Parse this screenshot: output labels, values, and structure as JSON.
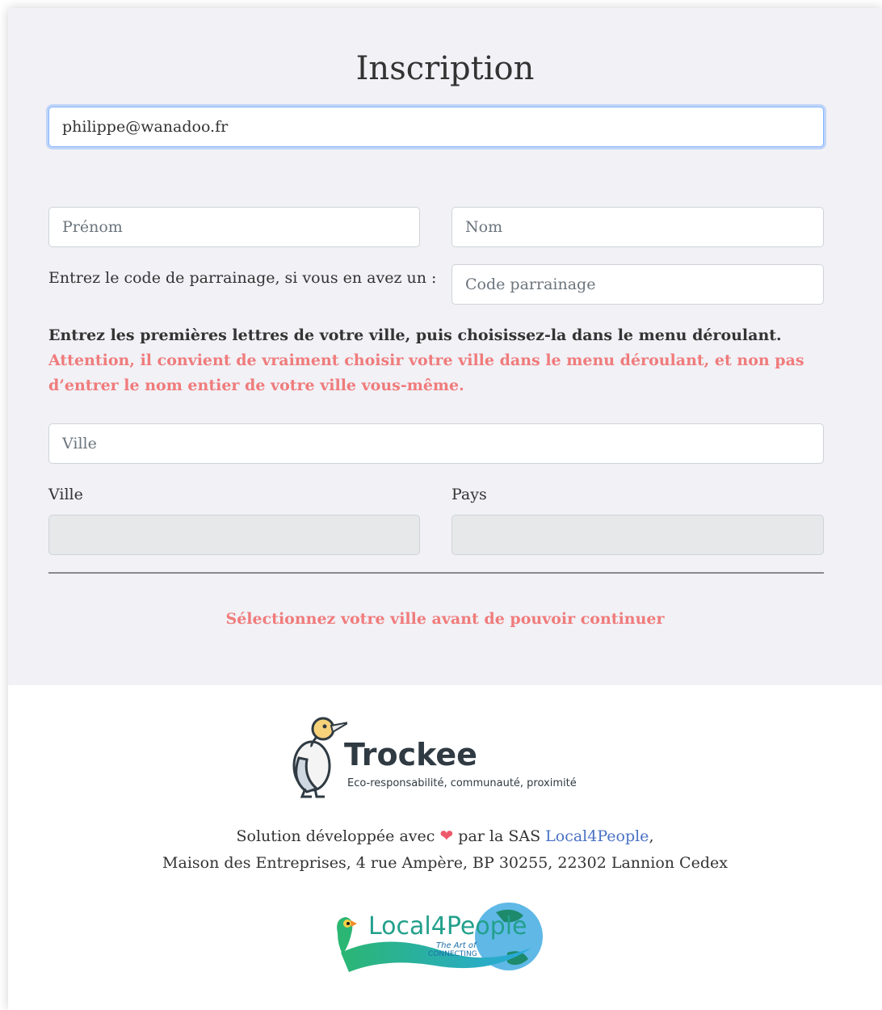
{
  "form": {
    "title": "Inscription",
    "email_value": "philippe@wanadoo.fr",
    "firstname_placeholder": "Prénom",
    "lastname_placeholder": "Nom",
    "referral_label": "Entrez le code de parrainage, si vous en avez un :",
    "referral_placeholder": "Code parrainage",
    "city_instruction": "Entrez les premières lettres de votre ville, puis choisissez-la dans le menu déroulant.",
    "city_warning": "Attention, il convient de vraiment choisir votre ville dans le menu déroulant, et non pas d’entrer le nom entier de votre ville vous-même.",
    "city_search_placeholder": "Ville",
    "city_label": "Ville",
    "country_label": "Pays",
    "city_value": "",
    "country_value": "",
    "continue_message": "Sélectionnez votre ville avant de pouvoir continuer"
  },
  "footer": {
    "brand_name": "Trockee",
    "brand_tagline": "Eco-responsabilité, communauté, proximité",
    "credits_prefix": "Solution développée avec",
    "credits_mid": "par la SAS",
    "company_link": "Local4People",
    "credits_suffix": ",",
    "address": "Maison des Entreprises, 4 rue Ampère, BP 30255, 22302 Lannion Cedex",
    "partner_logo_text": "Local4People",
    "partner_logo_tagline_1": "The Art of",
    "partner_logo_tagline_2": "CONNECTING"
  },
  "colors": {
    "warning": "#f07b7b",
    "link": "#4a72c4",
    "focus": "#86b7fe",
    "heart": "#ee5a6a"
  },
  "icons": [
    "heart-icon",
    "gannet-bird-logo",
    "parrot-globe-logo"
  ]
}
